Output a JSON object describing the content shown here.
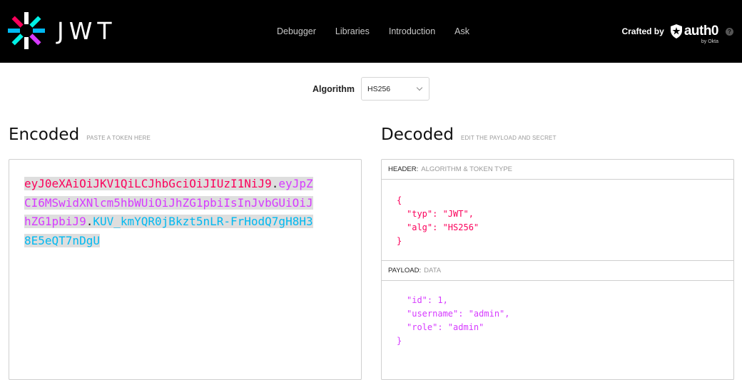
{
  "nav": {
    "brand": "JWT",
    "links": [
      "Debugger",
      "Libraries",
      "Introduction",
      "Ask"
    ],
    "crafted_by": "Crafted by",
    "partner": "auth0",
    "partner_sub": "by Okta",
    "help": "?"
  },
  "algorithm": {
    "label": "Algorithm",
    "selected": "HS256"
  },
  "encoded": {
    "title": "Encoded",
    "hint": "PASTE A TOKEN HERE",
    "token_header": "eyJ0eXAiOiJKV1QiLCJhbGciOiJIUzI1NiJ9",
    "token_payload": "eyJpZCI6MSwidXNlcm5hbWUiOiJhZG1pbiIsInJvbGUiOiJhZG1pbiJ9",
    "token_signature": "KUV_kmYQR0jBkzt5nLR-FrHodQ7gH8H38E5eQT7nDgU",
    "dot": "."
  },
  "decoded": {
    "title": "Decoded",
    "hint": "EDIT THE PAYLOAD AND SECRET",
    "header_label": "HEADER:",
    "header_sub": "ALGORITHM & TOKEN TYPE",
    "header_lines": [
      "{",
      "\"typ\": \"JWT\",",
      "\"alg\": \"HS256\"",
      "}"
    ],
    "payload_label": "PAYLOAD:",
    "payload_sub": "DATA",
    "payload_lines": [
      "\"id\": 1,",
      "\"username\": \"admin\",",
      "\"role\": \"admin\"",
      "}"
    ]
  },
  "colors": {
    "header": "#fb015b",
    "payload": "#d63aff",
    "signature": "#00b9f1"
  }
}
